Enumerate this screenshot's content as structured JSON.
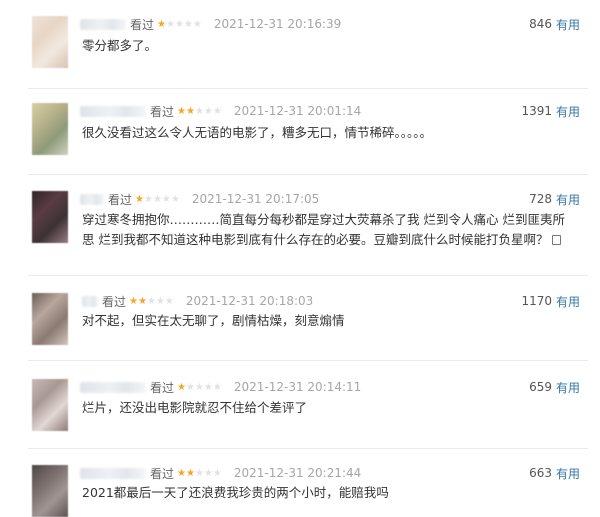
{
  "comments": [
    {
      "watched_label": "看过",
      "rating": 1,
      "time": "2021-12-31 20:16:39",
      "votes": "846",
      "useful_label": "有用",
      "content": "零分都多了。",
      "avatar_colors": [
        "#efe3d8",
        "#e8d5c4",
        "#f1e9e0",
        "#d9c2ad"
      ]
    },
    {
      "watched_label": "看过",
      "rating": 2,
      "time": "2021-12-31 20:01:14",
      "votes": "1391",
      "useful_label": "有用",
      "content": "很久没看过这么令人无语的电影了，糟多无口，情节稀碎。。。。。",
      "avatar_colors": [
        "#d6cfa4",
        "#b9b28a",
        "#8e9a7a",
        "#cfd2c2"
      ]
    },
    {
      "watched_label": "看过",
      "rating": 1,
      "time": "2021-12-31 20:17:05",
      "votes": "728",
      "useful_label": "有用",
      "content": "穿过寒冬拥抱你…………简直每分每秒都是穿过大荧幕杀了我 烂到令人痛心 烂到匪夷所思 烂到我都不知道这种电影到底有什么存在的必要。豆瓣到底什么时候能打负星啊？",
      "avatar_colors": [
        "#2d2424",
        "#5a3c44",
        "#3b3234",
        "#9b7c83"
      ]
    },
    {
      "watched_label": "看过",
      "rating": 2,
      "time": "2021-12-31 20:18:03",
      "votes": "1170",
      "useful_label": "有用",
      "content": "对不起，但实在太无聊了，剧情枯燥，刻意煽情",
      "avatar_colors": [
        "#6b5e58",
        "#b9a79d",
        "#8a7a71",
        "#d3c6be"
      ]
    },
    {
      "watched_label": "看过",
      "rating": 1,
      "time": "2021-12-31 20:14:11",
      "votes": "659",
      "useful_label": "有用",
      "content": "烂片，还没出电影院就忍不住给个差评了",
      "avatar_colors": [
        "#c9b9b5",
        "#a89893",
        "#e2d8d5",
        "#8c7a76"
      ]
    },
    {
      "watched_label": "看过",
      "rating": 2,
      "time": "2021-12-31 20:21:44",
      "votes": "663",
      "useful_label": "有用",
      "content": "2021都最后一天了还浪费我珍贵的两个小时，能赔我吗",
      "avatar_colors": [
        "#4d4545",
        "#7b6f6d",
        "#a19593",
        "#5e5452"
      ]
    }
  ]
}
